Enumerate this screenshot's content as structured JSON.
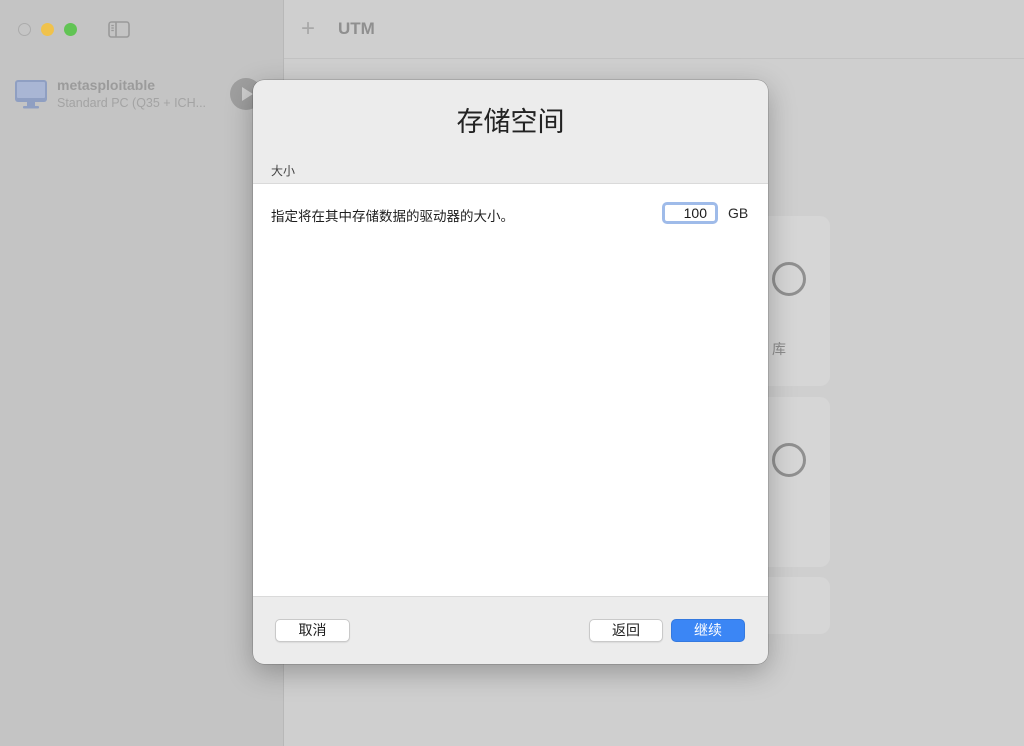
{
  "sidebar": {
    "vm": {
      "name": "metasploitable",
      "subtitle": "Standard PC (Q35 + ICH..."
    }
  },
  "toolbar": {
    "title": "UTM",
    "add_icon": "plus-icon"
  },
  "background_cards": {
    "card1_label": "库"
  },
  "modal": {
    "title": "存储空间",
    "section_label": "大小",
    "size_description": "指定将在其中存储数据的驱动器的大小。",
    "size_value": "100",
    "size_unit": "GB",
    "buttons": {
      "cancel": "取消",
      "back": "返回",
      "continue": "继续"
    }
  },
  "colors": {
    "accent": "#3b86f5",
    "focus_ring": "#9fbbe9",
    "traffic_min": "#f0c24c",
    "traffic_max": "#61c454"
  }
}
